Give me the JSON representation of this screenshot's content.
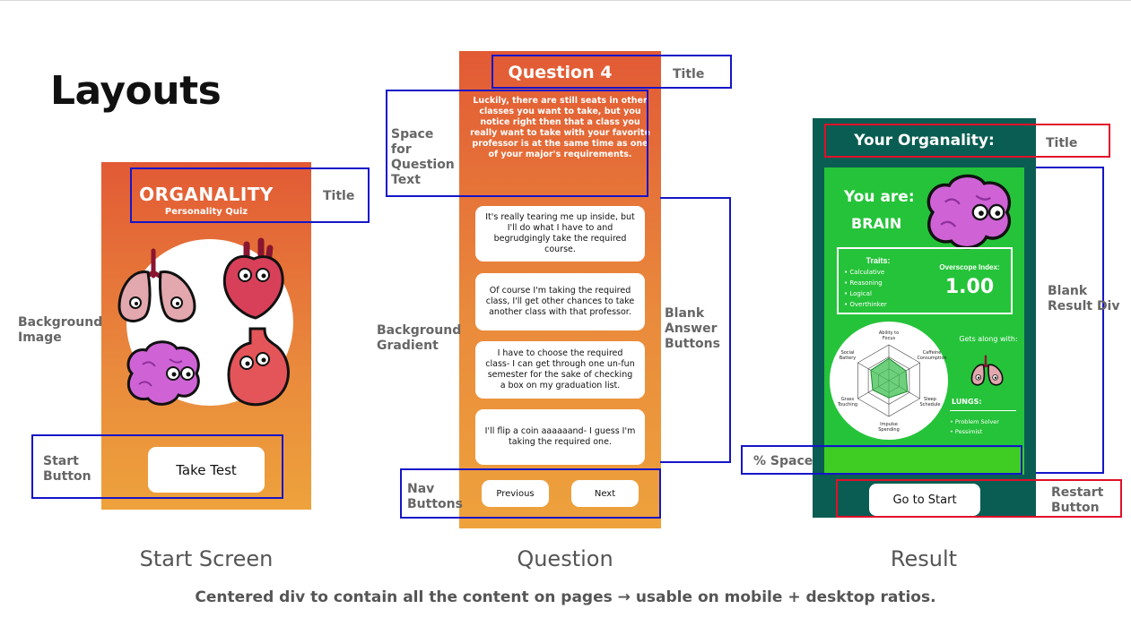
{
  "page": {
    "title": "Layouts",
    "footer": "Centered div to contain all the content on pages → usable on mobile + desktop ratios."
  },
  "captions": {
    "start": "Start Screen",
    "question": "Question",
    "result": "Result"
  },
  "annotations": {
    "start_title": "Title",
    "background_image": "Background Image",
    "start_button": "Start Button",
    "question_text_space": "Space for Question Text",
    "question_title": "Title",
    "background_gradient": "Background Gradient",
    "blank_answer_buttons": "Blank Answer Buttons",
    "nav_buttons": "Nav Buttons",
    "result_title": "Title",
    "blank_result_div": "Blank Result Div",
    "percent_space": "% Space",
    "restart_button": "Restart Button"
  },
  "start_screen": {
    "title": "ORGANALITY",
    "subtitle": "Personality Quiz",
    "button": "Take Test"
  },
  "question_screen": {
    "title": "Question 4",
    "text": "Luckily, there are still seats in other classes you want to take, but you notice right then that a class you really want to take with your favorite professor is at the same time as one of your major's requirements.",
    "answers": [
      "It's really tearing me up inside, but I'll do what I have to and begrudgingly take the required course.",
      "Of course I'm taking the required class, I'll get other chances to take another class with that professor.",
      "I have to choose the required class- I can get through one un-fun semester for the sake of checking a box on my graduation list.",
      "I'll flip a coin aaaaaand- I guess I'm taking the required one."
    ],
    "prev_button": "Previous",
    "next_button": "Next"
  },
  "result_screen": {
    "title": "Your Organality:",
    "you_are": "You are:",
    "type": "BRAIN",
    "traits_label": "Traits:",
    "traits": [
      "Calculative",
      "Reasoning",
      "Logical",
      "Overthinker"
    ],
    "overscope_label": "Overscope Index:",
    "overscope_value": "1.00",
    "radar_labels": [
      "Ability to Focus",
      "Caffeine Consumption",
      "Sleep Schedule",
      "Impulse Spending",
      "Grass Touching",
      "Social Battery"
    ],
    "radar_values": [
      0.62,
      0.55,
      0.6,
      0.48,
      0.52,
      0.58
    ],
    "gets_along": "Gets along with:",
    "match": "LUNGS:",
    "match_traits": [
      "Problem Solver",
      "Pessimist"
    ],
    "restart_button": "Go to Start"
  },
  "colors": {
    "gradient_top": "#e25a35",
    "gradient_bottom": "#eea23c",
    "result_bg": "#0a5d52",
    "result_panel": "#25c33a",
    "annotation_blue": "#1515c8",
    "annotation_red": "#e0102a"
  }
}
